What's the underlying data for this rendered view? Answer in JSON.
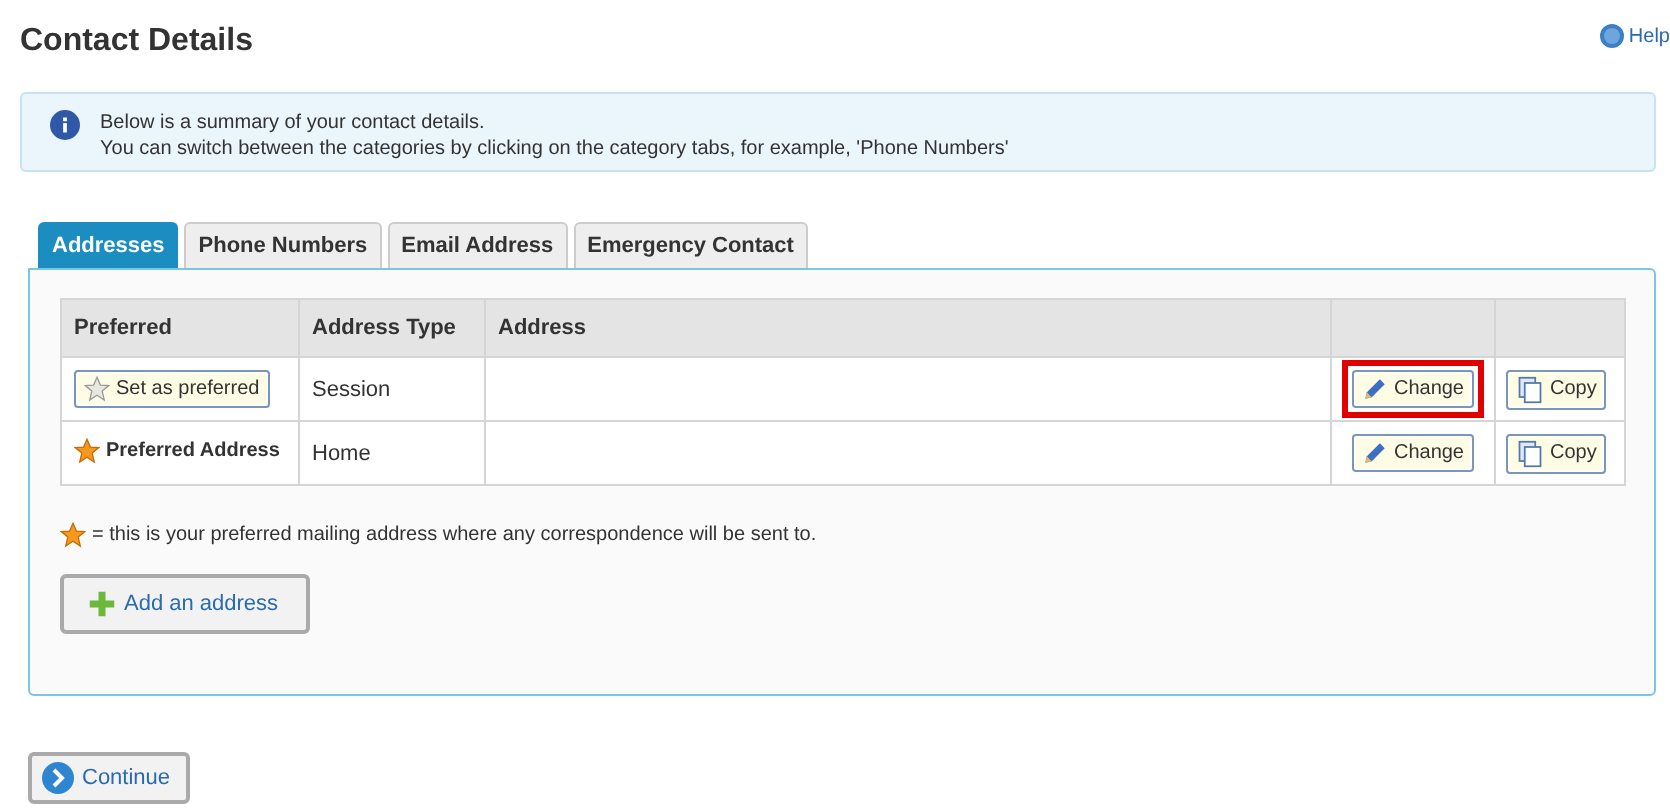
{
  "title": "Contact Details",
  "help": {
    "label": "Help"
  },
  "info": {
    "lines": [
      "Below is a summary of your contact details.",
      "You can switch between the categories by clicking on the category tabs, for example, 'Phone Numbers'"
    ]
  },
  "tabs": [
    {
      "label": "Addresses",
      "selected": true
    },
    {
      "label": "Phone Numbers",
      "selected": false
    },
    {
      "label": "Email Address",
      "selected": false
    },
    {
      "label": "Emergency Contact",
      "selected": false
    }
  ],
  "table": {
    "columns": [
      "Preferred",
      "Address Type",
      "Address"
    ],
    "rows": [
      {
        "preferred": {
          "kind": "button",
          "label": "Set as preferred"
        },
        "address_type": "Session",
        "change": "Change",
        "copy": "Copy",
        "highlighted": true
      },
      {
        "preferred": {
          "kind": "label",
          "label": "Preferred Address"
        },
        "address_type": "Home",
        "change": "Change",
        "copy": "Copy",
        "highlighted": false
      }
    ]
  },
  "note": "= this is your preferred mailing address where any correspondence will be sent to.",
  "add_button": "Add an address",
  "continue_button": "Continue"
}
